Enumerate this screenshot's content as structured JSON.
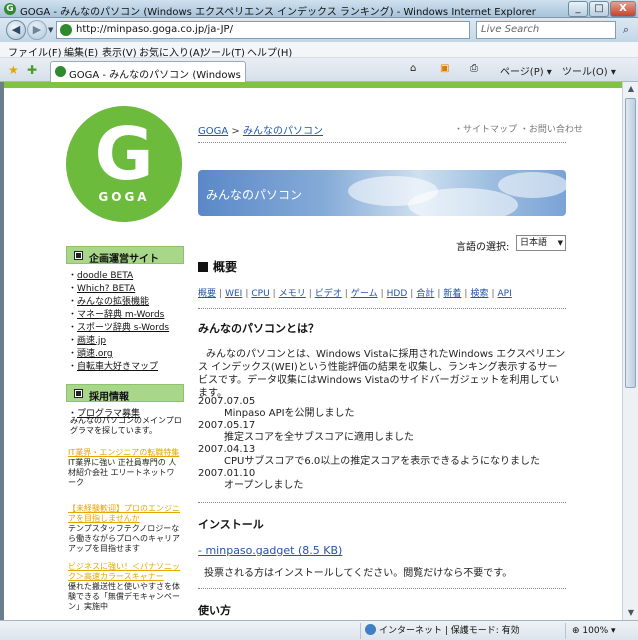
{
  "window": {
    "title": "GOGA - みんなのパソコン (Windows エクスペリエンス インデックス ランキング) - Windows Internet Explorer",
    "min_label": "_",
    "max_label": "□",
    "close_label": "X"
  },
  "address": {
    "url": "http://minpaso.goga.co.jp/ja-JP/",
    "search_placeholder": "Live Search"
  },
  "menu": [
    "ファイル(F)",
    "編集(E)",
    "表示(V)",
    "お気に入り(A)",
    "ツール(T)",
    "ヘルプ(H)"
  ],
  "tab": {
    "label": "GOGA - みんなのパソコン (Windows エクスペ...",
    "home_label": "⌂",
    "feed_label": "▣",
    "print_label": "⎙",
    "page_label": "ページ(P) ▾",
    "tools_label": "ツール(O) ▾"
  },
  "sidebar": {
    "logo_text": "GOGA",
    "logo_glyph": "G",
    "planning_title": "企画運営サイト",
    "planning_links": [
      "doodle BETA",
      "Which? BETA",
      "みんなの拡張機能",
      "マネー辞典 m-Words",
      "スポーツ辞典 s-Words",
      "画速.jp",
      "頭速.org",
      "自転車大好きマップ"
    ],
    "jobs_title": "採用情報",
    "jobs_link": "プログラマ募集",
    "jobs_text": "みんなのパソコンのメインプログラマを探しています。",
    "ads": [
      {
        "link": "IT業界・エンジニアの転職特集",
        "desc": "IT業界に強い 正社員専門の 人材紹介会社 エリートネットワーク"
      },
      {
        "link": "【未経験歓迎】プロのエンジニアを目指しませんか",
        "desc": "テンプスタッフテクノロジーなら働きながらプロへのキャリアアップを目指せます"
      },
      {
        "link": "ビジネスに強い！＜パナソニック＞高速カラースキャナー",
        "desc": "優れた搬送性と使いやすさを体験できる「無償デモキャンペーン」実施中"
      }
    ]
  },
  "main": {
    "breadcrumb_root": "GOGA",
    "breadcrumb_sep": ">",
    "breadcrumb_current": "みんなのパソコン",
    "sitemap": "・サイトマップ",
    "contact": "・お問い合わせ",
    "banner_text": "みんなのパソコン",
    "lang_label": "言語の選択:",
    "lang_value": "日本語",
    "section_title": "概要",
    "nav_links": [
      "概要",
      "WEI",
      "CPU",
      "メモリ",
      "ビデオ",
      "ゲーム",
      "HDD",
      "合計",
      "新着",
      "検索",
      "API"
    ],
    "about_title": "みんなのパソコンとは？",
    "about_text": "みんなのパソコンとは、Windows Vistaに採用されたWindows エクスペリエンス インデックス(WEI)という性能評価の結果を収集し、ランキング表示するサービスです。データ収集にはWindows Vistaのサイドバーガジェットを利用しています。",
    "news": [
      {
        "date": "2007.07.05",
        "text": "Minpaso APIを公開しました"
      },
      {
        "date": "2007.05.17",
        "text": "推定スコアを全サブスコアに適用しました"
      },
      {
        "date": "2007.04.13",
        "text": "CPUサブスコアで6.0以上の推定スコアを表示できるようになりました"
      },
      {
        "date": "2007.01.10",
        "text": "オープンしました"
      }
    ],
    "install_title": "インストール",
    "download_link": "- minpaso.gadget (8.5 KB)",
    "download_note": "投票される方はインストールしてください。閲覧だけなら不要です。",
    "usage_title": "使い方"
  },
  "status": {
    "zone": "インターネット | 保護モード: 有効",
    "zoom": "100%"
  }
}
